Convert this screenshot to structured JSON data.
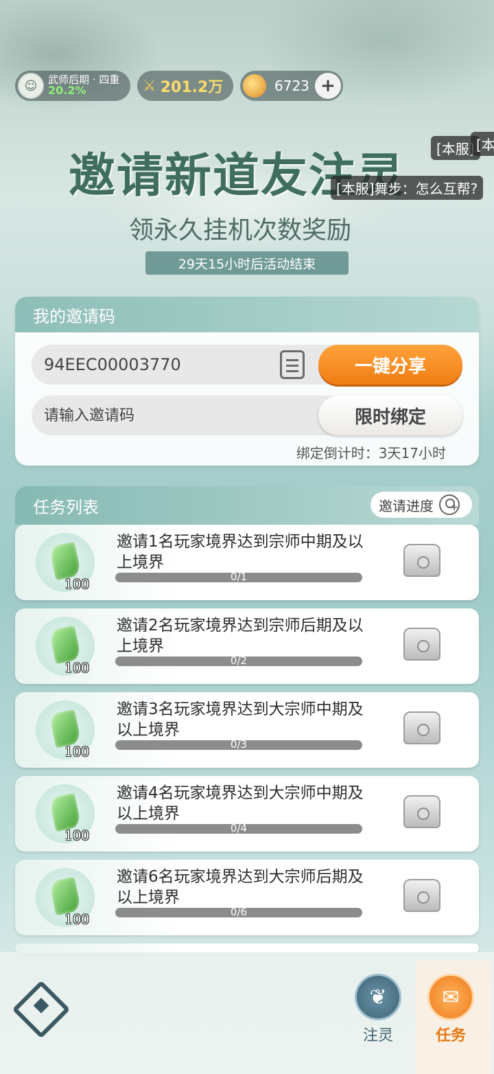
{
  "status": {
    "rank_name": "武师后期 · 四重",
    "rank_progress": "20.2%",
    "power": "201.2万",
    "coins": "6723"
  },
  "banner": {
    "title": "邀请新道友注灵",
    "subtitle": "领永久挂机次数奖励",
    "timer": "29天15小时后活动结束"
  },
  "chat": {
    "msg1": "[本服]",
    "msg2": "[本",
    "msg3": "[本服]舞步：怎么互帮?"
  },
  "invite": {
    "header": "我的邀请码",
    "code": "94EEC00003770",
    "share_label": "一键分享",
    "input_placeholder": "请输入邀请码",
    "bind_label": "限时绑定",
    "countdown": "绑定倒计时：3天17小时"
  },
  "tasks": {
    "header": "任务列表",
    "progress_label": "邀请进度",
    "items": [
      {
        "desc": "邀请1名玩家境界达到宗师中期及以上境界",
        "reward": "100",
        "progress": "0/1",
        "fraction": 0
      },
      {
        "desc": "邀请2名玩家境界达到宗师后期及以上境界",
        "reward": "100",
        "progress": "0/2",
        "fraction": 0
      },
      {
        "desc": "邀请3名玩家境界达到大宗师中期及以上境界",
        "reward": "100",
        "progress": "0/3",
        "fraction": 0
      },
      {
        "desc": "邀请4名玩家境界达到大宗师中期及以上境界",
        "reward": "100",
        "progress": "0/4",
        "fraction": 0
      },
      {
        "desc": "邀请6名玩家境界达到大宗师后期及以上境界",
        "reward": "100",
        "progress": "0/6",
        "fraction": 0
      }
    ]
  },
  "nav": {
    "zhuling": "注灵",
    "task": "任务"
  },
  "colors": {
    "accent": "#f07e14",
    "header": "#8ebeb8",
    "progress_green": "#8ff07a"
  }
}
